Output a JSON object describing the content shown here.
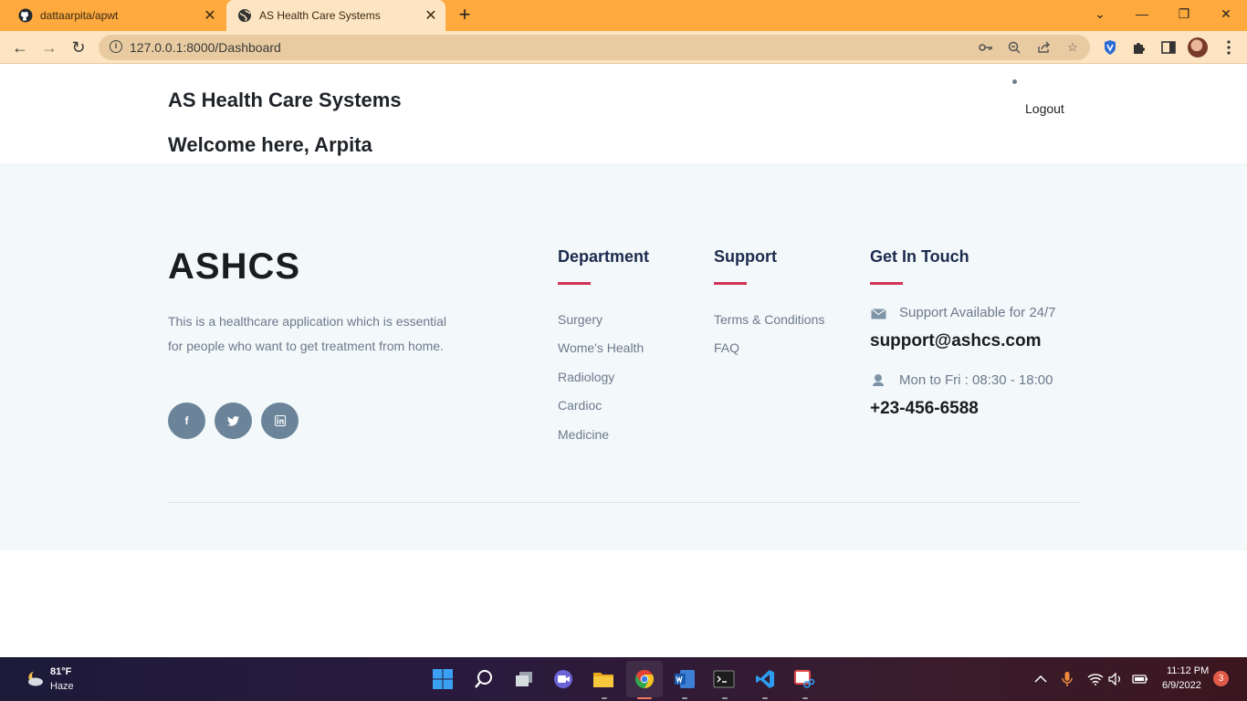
{
  "browser": {
    "tabs": [
      {
        "title": "dattaarpita/apwt",
        "favicon": "github-icon"
      },
      {
        "title": "AS Health Care Systems",
        "favicon": "globe-icon"
      }
    ],
    "url": "127.0.0.1:8000/Dashboard"
  },
  "header": {
    "brand": "AS Health Care Systems",
    "welcome": "Welcome here, Arpita",
    "logout": "Logout"
  },
  "footer": {
    "logo": "ASHCS",
    "description": "This is a healthcare application which is essential for people who want to get treatment from home.",
    "social": [
      {
        "label": "f",
        "icon": "facebook-icon"
      },
      {
        "label": "t",
        "icon": "twitter-icon"
      },
      {
        "label": "in",
        "icon": "linkedin-icon"
      }
    ],
    "department": {
      "heading": "Department",
      "links": [
        "Surgery",
        "Wome's Health",
        "Radiology",
        "Cardioc",
        "Medicine"
      ]
    },
    "support": {
      "heading": "Support",
      "links": [
        "Terms & Conditions",
        "FAQ"
      ]
    },
    "contact": {
      "heading": "Get In Touch",
      "email_label": "Support Available for 24/7",
      "email": "support@ashcs.com",
      "hours_label": "Mon to Fri : 08:30 - 18:00",
      "phone": "+23-456-6588"
    }
  },
  "taskbar": {
    "weather_temp": "81°F",
    "weather_desc": "Haze",
    "time": "11:12 PM",
    "date": "6/9/2022",
    "notifications": "3"
  },
  "colors": {
    "tabbar": "#ffaa3f",
    "accent_bar": "#d23256",
    "heading": "#1d2b4f",
    "footer_bg": "#f3f8fa"
  }
}
